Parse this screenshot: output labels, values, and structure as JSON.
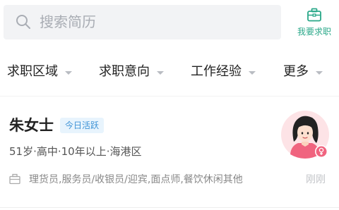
{
  "search": {
    "placeholder": "搜索简历"
  },
  "job_button": {
    "label": "我要求职"
  },
  "filters": [
    {
      "label": "求职区域"
    },
    {
      "label": "求职意向"
    },
    {
      "label": "工作经验"
    },
    {
      "label": "更多"
    }
  ],
  "candidate": {
    "name": "朱女士",
    "badge": "今日活跃",
    "meta": "51岁·高中·10年以上·海港区",
    "intent": "理货员,服务员/收银员/迎宾,面点师,餐饮休闲其他",
    "time": "刚刚",
    "gender_icon": "female-icon"
  },
  "colors": {
    "accent": "#2aa889",
    "badge_text": "#3e93d6",
    "badge_bg": "#e8f4fd",
    "avatar_bg": "#fde3e6",
    "gender": "#f0647f"
  }
}
